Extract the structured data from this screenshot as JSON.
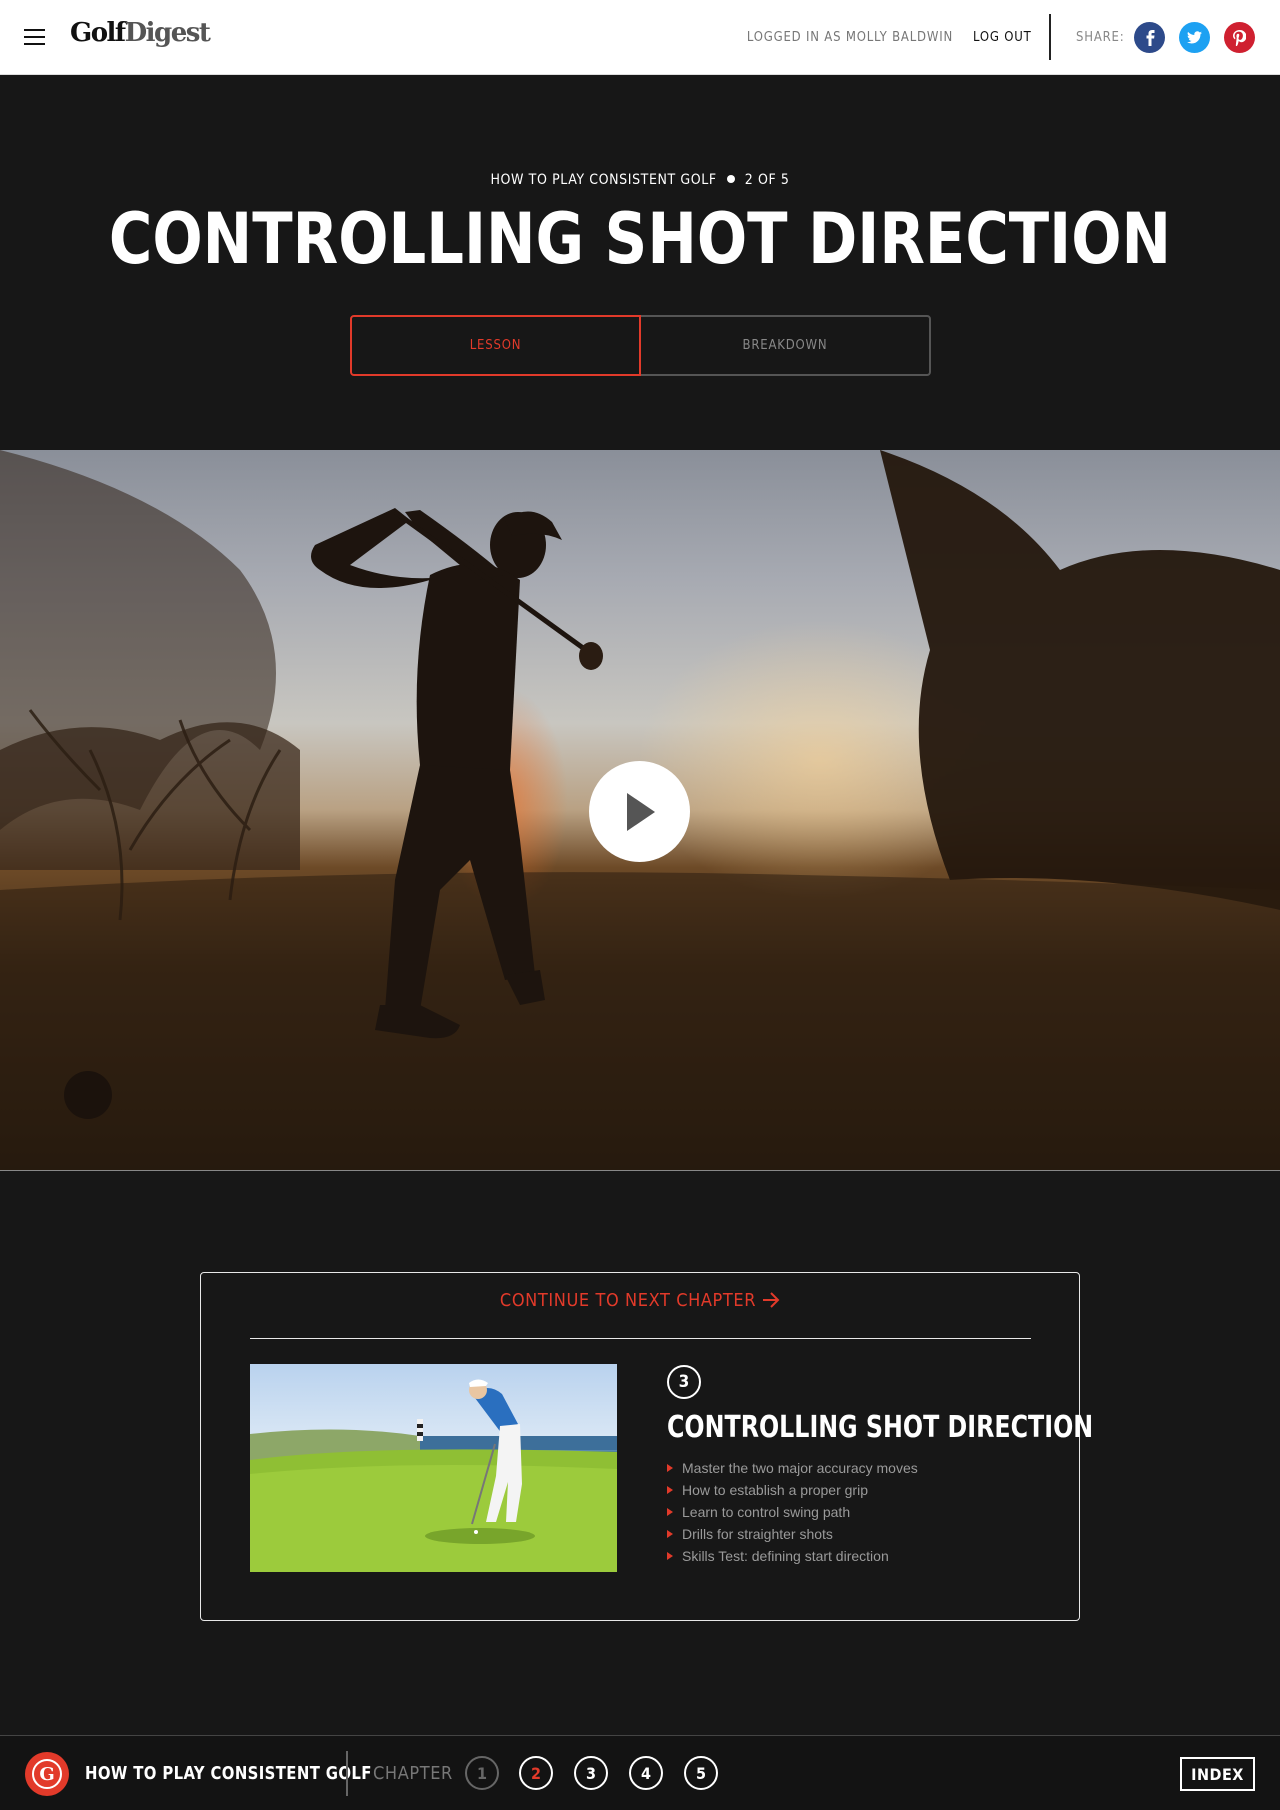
{
  "header": {
    "menu_icon": "hamburger-icon",
    "logo_part1": "Golf",
    "logo_part2": "Digest",
    "user_info": "LOGGED IN AS MOLLY BALDWIN",
    "logout_label": "LOG OUT",
    "share_label": "SHARE:",
    "social": [
      {
        "name": "facebook-icon",
        "glyph": "f",
        "color": "#2d4a8a"
      },
      {
        "name": "twitter-icon",
        "glyph": "t",
        "color": "#1da1f2"
      },
      {
        "name": "pinterest-icon",
        "glyph": "p",
        "color": "#cf2030"
      }
    ]
  },
  "hero": {
    "course": "HOW TO PLAY CONSISTENT GOLF",
    "progress": "2 OF 5",
    "title": "CONTROLLING SHOT DIRECTION",
    "tabs": [
      {
        "label": "LESSON",
        "active": true
      },
      {
        "label": "BREAKDOWN",
        "active": false
      }
    ]
  },
  "video": {
    "play_icon": "play-icon"
  },
  "next_chapter": {
    "link_label": "CONTINUE TO NEXT CHAPTER",
    "arrow_icon": "arrow-right-icon",
    "number": "3",
    "title": "CONTROLLING SHOT DIRECTION",
    "bullets": [
      "Master the two major accuracy moves",
      "How to establish a proper grip",
      "Learn to control swing path",
      "Drills for straighter shots",
      "Skills Test: defining start direction"
    ]
  },
  "bottom_bar": {
    "school_logo_letter": "G",
    "course_name": "HOW TO PLAY CONSISTENT GOLF",
    "chapter_label": "CHAPTER",
    "chapters": [
      "1",
      "2",
      "3",
      "4",
      "5"
    ],
    "current_chapter": "2",
    "index_label": "INDEX"
  },
  "colors": {
    "accent": "#e23a2a",
    "background": "#171717",
    "header_bg": "#ffffff"
  }
}
